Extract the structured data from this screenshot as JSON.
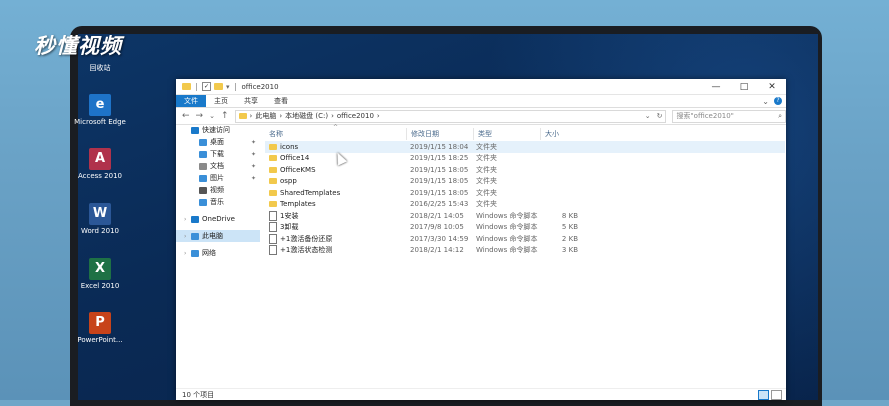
{
  "watermark": {
    "logo_text": "秒懂视频"
  },
  "desktop": {
    "icons": [
      {
        "name": "recycle-bin",
        "label": "回收站",
        "color": "#7f8c8d",
        "glyph": ""
      },
      {
        "name": "edge",
        "label": "Microsoft Edge",
        "color": "#1e73c8",
        "glyph": "e"
      },
      {
        "name": "access",
        "label": "Access 2010",
        "color": "#b0324b",
        "glyph": "A"
      },
      {
        "name": "word",
        "label": "Word 2010",
        "color": "#2b5797",
        "glyph": "W"
      },
      {
        "name": "excel",
        "label": "Excel 2010",
        "color": "#1e7145",
        "glyph": "X"
      },
      {
        "name": "powerpoint",
        "label": "PowerPoint...",
        "color": "#c7431a",
        "glyph": "P"
      }
    ]
  },
  "explorer": {
    "title": "office2010",
    "window_controls": {
      "minimize": "—",
      "maximize": "□",
      "close": "✕"
    },
    "ribbon_tabs": [
      {
        "label": "文件",
        "active": true
      },
      {
        "label": "主页",
        "active": false
      },
      {
        "label": "共享",
        "active": false
      },
      {
        "label": "查看",
        "active": false
      }
    ],
    "ribbon_expand": "⌄",
    "ribbon_help": "?",
    "nav": {
      "back": "←",
      "forward": "→",
      "recent": "⌄",
      "up": "↑"
    },
    "breadcrumb": [
      "此电脑",
      "本地磁盘 (C:)",
      "office2010"
    ],
    "breadcrumb_sep": "›",
    "address_dropdown": "⌄",
    "address_refresh": "↻",
    "search_placeholder": "搜索\"office2010\"",
    "search_icon": "⌕",
    "nav_pane": [
      {
        "label": "快速访问",
        "icon": "star",
        "color": "#1979ca",
        "indent": 8,
        "pinned": false,
        "selected": false,
        "chevron": ""
      },
      {
        "label": "桌面",
        "icon": "desktop",
        "color": "#3a8fd8",
        "indent": 16,
        "pinned": true,
        "selected": false,
        "chevron": ""
      },
      {
        "label": "下载",
        "icon": "download",
        "color": "#3a8fd8",
        "indent": 16,
        "pinned": true,
        "selected": false,
        "chevron": ""
      },
      {
        "label": "文档",
        "icon": "document",
        "color": "#8a8a8a",
        "indent": 16,
        "pinned": true,
        "selected": false,
        "chevron": ""
      },
      {
        "label": "图片",
        "icon": "picture",
        "color": "#3a8fd8",
        "indent": 16,
        "pinned": true,
        "selected": false,
        "chevron": ""
      },
      {
        "label": "视频",
        "icon": "video",
        "color": "#555555",
        "indent": 16,
        "pinned": false,
        "selected": false,
        "chevron": ""
      },
      {
        "label": "音乐",
        "icon": "music",
        "color": "#3a8fd8",
        "indent": 16,
        "pinned": false,
        "selected": false,
        "chevron": ""
      },
      {
        "label": "",
        "spacer": true
      },
      {
        "label": "OneDrive",
        "icon": "cloud",
        "color": "#1979ca",
        "indent": 8,
        "pinned": false,
        "selected": false,
        "chevron": "›"
      },
      {
        "label": "",
        "spacer": true
      },
      {
        "label": "此电脑",
        "icon": "computer",
        "color": "#3a8fd8",
        "indent": 8,
        "pinned": false,
        "selected": true,
        "chevron": "›"
      },
      {
        "label": "",
        "spacer": true
      },
      {
        "label": "网络",
        "icon": "network",
        "color": "#3a8fd8",
        "indent": 8,
        "pinned": false,
        "selected": false,
        "chevron": "›"
      }
    ],
    "pin_glyph": "✦",
    "columns": {
      "name": "名称",
      "modified": "修改日期",
      "type": "类型",
      "size": "大小"
    },
    "sort_arrow": "^",
    "files": [
      {
        "name": "icons",
        "modified": "2019/1/15 18:04",
        "type": "文件夹",
        "size": "",
        "kind": "folder",
        "highlight": true
      },
      {
        "name": "Office14",
        "modified": "2019/1/15 18:25",
        "type": "文件夹",
        "size": "",
        "kind": "folder",
        "highlight": false
      },
      {
        "name": "OfficeKMS",
        "modified": "2019/1/15 18:05",
        "type": "文件夹",
        "size": "",
        "kind": "folder",
        "highlight": false
      },
      {
        "name": "ospp",
        "modified": "2019/1/15 18:05",
        "type": "文件夹",
        "size": "",
        "kind": "folder",
        "highlight": false
      },
      {
        "name": "SharedTemplates",
        "modified": "2019/1/15 18:05",
        "type": "文件夹",
        "size": "",
        "kind": "folder",
        "highlight": false
      },
      {
        "name": "Templates",
        "modified": "2016/2/25 15:43",
        "type": "文件夹",
        "size": "",
        "kind": "folder",
        "highlight": false
      },
      {
        "name": "1安装",
        "modified": "2018/2/1 14:05",
        "type": "Windows 命令脚本",
        "size": "8 KB",
        "kind": "cmd",
        "highlight": false
      },
      {
        "name": "3卸载",
        "modified": "2017/9/8 10:05",
        "type": "Windows 命令脚本",
        "size": "5 KB",
        "kind": "cmd",
        "highlight": false
      },
      {
        "name": "+1激活备份还原",
        "modified": "2017/3/30 14:59",
        "type": "Windows 命令脚本",
        "size": "2 KB",
        "kind": "cmd",
        "highlight": false
      },
      {
        "name": "+1激活状态检测",
        "modified": "2018/2/1 14:12",
        "type": "Windows 命令脚本",
        "size": "3 KB",
        "kind": "cmd",
        "highlight": false
      }
    ],
    "status": "10 个项目"
  }
}
